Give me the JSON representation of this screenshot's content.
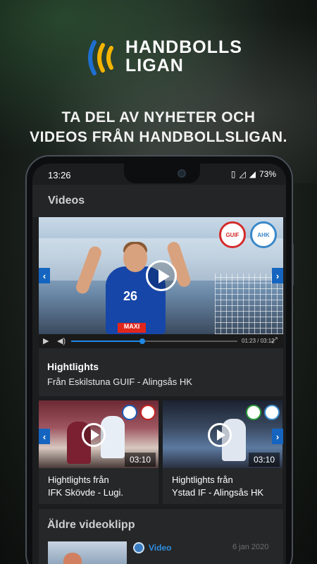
{
  "brand": {
    "name_line1": "HANDBOLLS",
    "name_line2": "LIGAN"
  },
  "tagline": {
    "line1": "TA DEL AV NYHETER OCH",
    "line2": "VIDEOS FRÅN HANDBOLLSLIGAN."
  },
  "status_bar": {
    "time": "13:26",
    "battery": "73%"
  },
  "app": {
    "section_title": "Videos"
  },
  "featured": {
    "team_home": "GUIF",
    "team_away": "AHK",
    "jersey_number": "26",
    "jersey_sponsor": "MAXI",
    "duration": "01:23 / 03:12",
    "progress_fraction": 0.43,
    "title": "Hightlights",
    "subtitle": "Från Eskilstuna GUIF - Alingsås HK"
  },
  "cards": [
    {
      "line1": "Hightlights från",
      "line2": "IFK Skövde - Lugi.",
      "duration": "03:10"
    },
    {
      "line1": "Hightlights från",
      "line2": "Ystad IF - Alingsås HK",
      "duration": "03:10"
    }
  ],
  "older": {
    "title": "Äldre videoklipp",
    "item_type": "Video",
    "item_date": "6 jan 2020"
  },
  "colors": {
    "accent_blue": "#1e88e5",
    "brand_yellow": "#f5b400",
    "brand_blue": "#1e6fd0"
  }
}
